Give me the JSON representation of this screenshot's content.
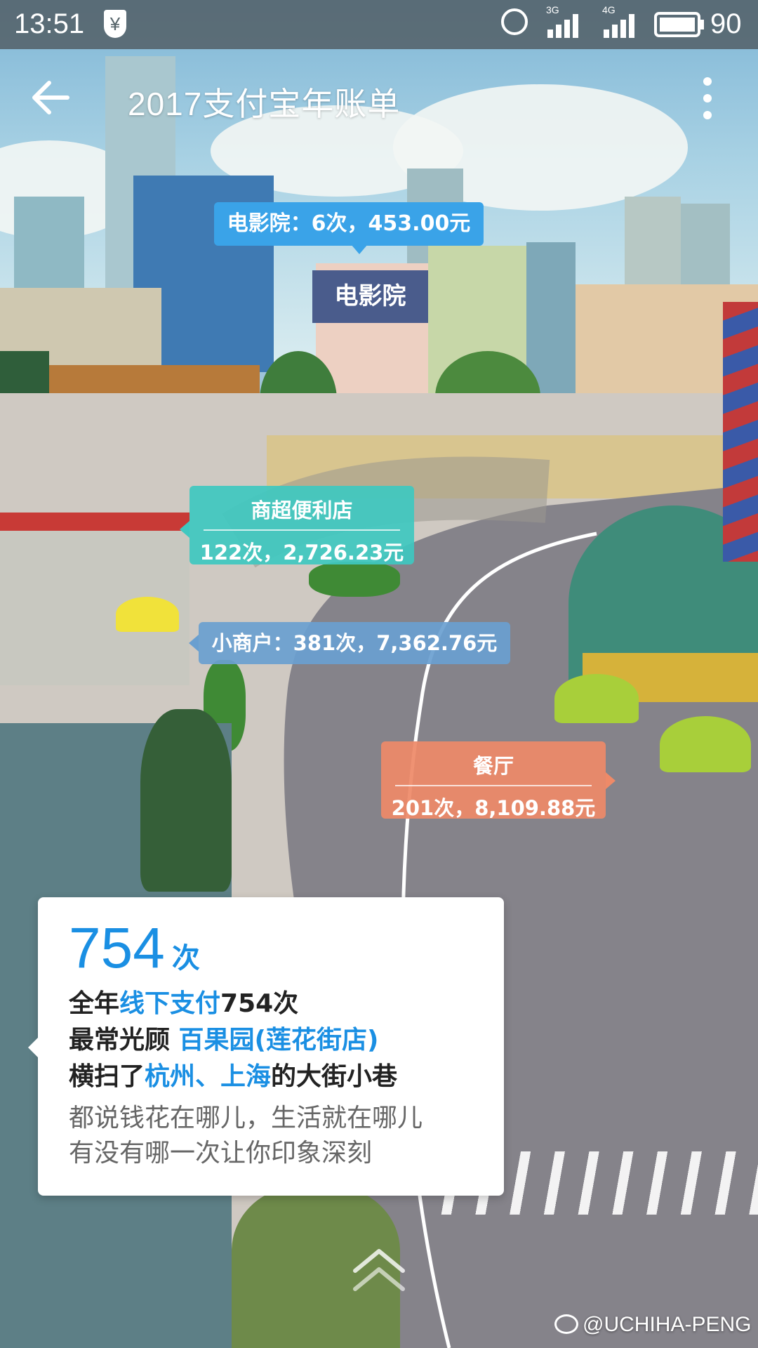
{
  "status_bar": {
    "time": "13:51",
    "signal_1": "3G",
    "signal_2": "4G",
    "battery": "90"
  },
  "header": {
    "title": "2017支付宝年账单"
  },
  "bubbles": {
    "cinema": "电影院：6次，453.00元",
    "supermarket_title": "商超便利店",
    "supermarket_value": "122次，2,726.23元",
    "small_merchant": "小商户：381次，7,362.76元",
    "restaurant_title": "餐厅",
    "restaurant_value": "201次，8,109.88元"
  },
  "scene_text": {
    "cinema_sign": "电影院"
  },
  "summary": {
    "count": "754",
    "count_unit": "次",
    "line1_a": "全年",
    "line1_b": "线下支付",
    "line1_c": "754次",
    "line2_a": "最常光顾 ",
    "line2_b": "百果园(莲花街店)",
    "line3_a": "横扫了",
    "line3_b": "杭州、上海",
    "line3_c": "的大街小巷",
    "line4": "都说钱花在哪儿，生活就在哪儿",
    "line5": "有没有哪一次让你印象深刻"
  },
  "watermark": "@UCHIHA-PENG",
  "colors": {
    "accent": "#1a8fe3",
    "bubble_blue": "#3aa3e8",
    "bubble_teal": "#3fc8c0",
    "bubble_slate": "#6a9fd0",
    "bubble_orange": "#ee8a68"
  }
}
